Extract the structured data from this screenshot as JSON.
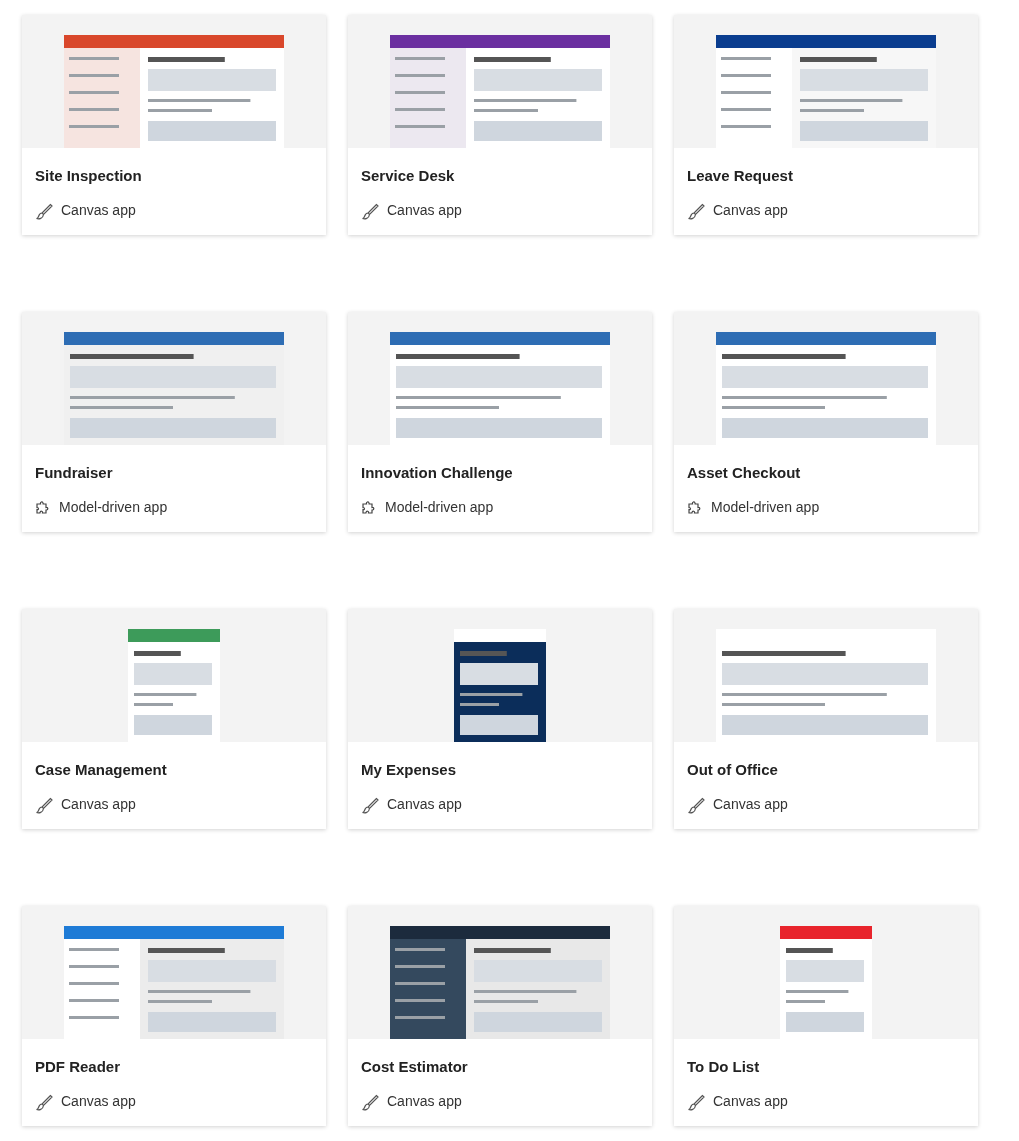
{
  "cards": [
    {
      "title": "Site Inspection",
      "app": {
        "kind": "canvas",
        "label": "Canvas app"
      }
    },
    {
      "title": "Service Desk",
      "app": {
        "kind": "canvas",
        "label": "Canvas app"
      }
    },
    {
      "title": "Leave Request",
      "app": {
        "kind": "canvas",
        "label": "Canvas app"
      }
    },
    {
      "title": "Fundraiser",
      "app": {
        "kind": "model",
        "label": "Model-driven app"
      }
    },
    {
      "title": "Innovation Challenge",
      "app": {
        "kind": "model",
        "label": "Model-driven app"
      }
    },
    {
      "title": "Asset Checkout",
      "app": {
        "kind": "model",
        "label": "Model-driven app"
      }
    },
    {
      "title": "Case Management",
      "app": {
        "kind": "canvas",
        "label": "Canvas app"
      }
    },
    {
      "title": "My Expenses",
      "app": {
        "kind": "canvas",
        "label": "Canvas app"
      }
    },
    {
      "title": "Out of Office",
      "app": {
        "kind": "canvas",
        "label": "Canvas app"
      }
    },
    {
      "title": "PDF Reader",
      "app": {
        "kind": "canvas",
        "label": "Canvas app"
      }
    },
    {
      "title": "Cost Estimator",
      "app": {
        "kind": "canvas",
        "label": "Canvas app"
      }
    },
    {
      "title": "To Do List",
      "app": {
        "kind": "canvas",
        "label": "Canvas app"
      }
    }
  ]
}
